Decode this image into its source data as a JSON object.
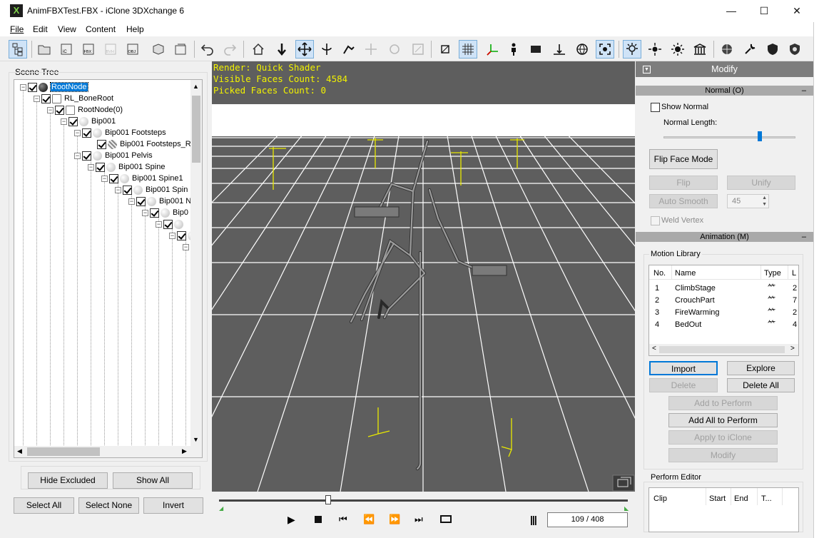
{
  "window": {
    "title": "AnimFBXTest.FBX - iClone 3DXchange 6",
    "minimize": "—",
    "maximize": "☐",
    "close": "✕"
  },
  "menu": [
    {
      "label": "File"
    },
    {
      "label": "Edit"
    },
    {
      "label": "View"
    },
    {
      "label": "Content"
    },
    {
      "label": "Help"
    }
  ],
  "scene_tree": {
    "label": "Scene Tree",
    "nodes": [
      {
        "label": "RootNode",
        "selected": true
      },
      {
        "label": "RL_BoneRoot"
      },
      {
        "label": "RootNode(0)"
      },
      {
        "label": "Bip001"
      },
      {
        "label": "Bip001 Footsteps"
      },
      {
        "label": "Bip001 Footsteps_R"
      },
      {
        "label": "Bip001 Pelvis"
      },
      {
        "label": "Bip001 Spine"
      },
      {
        "label": "Bip001 Spine1"
      },
      {
        "label": "Bip001 Spin"
      },
      {
        "label": "Bip001 N"
      },
      {
        "label": "Bip0"
      }
    ],
    "buttons": {
      "hide_excluded": "Hide Excluded",
      "show_all": "Show All",
      "select_all": "Select All",
      "select_none": "Select None",
      "invert": "Invert"
    }
  },
  "viewport": {
    "render": "Render: Quick Shader",
    "visible_faces": "Visible Faces Count: 4584",
    "picked_faces": "Picked Faces Count: 0"
  },
  "timeline": {
    "frame": "109 / 408",
    "progress": 0.267
  },
  "modify": {
    "title": "Modify",
    "normal_section": "Normal (O)",
    "show_normal": "Show Normal",
    "normal_length": "Normal Length:",
    "flip_face_mode": "Flip Face Mode",
    "flip": "Flip",
    "unify": "Unify",
    "auto_smooth": "Auto Smooth",
    "smooth_value": "45",
    "weld_vertex": "Weld Vertex",
    "animation_section": "Animation (M)",
    "motion_library": "Motion Library",
    "columns": {
      "no": "No.",
      "name": "Name",
      "type": "Type",
      "l": "L"
    },
    "motions": [
      {
        "no": "1",
        "name": "ClimbStage",
        "len": "2"
      },
      {
        "no": "2",
        "name": "CrouchPart",
        "len": "7"
      },
      {
        "no": "3",
        "name": "FireWarming",
        "len": "2"
      },
      {
        "no": "4",
        "name": "BedOut",
        "len": "4"
      }
    ],
    "import": "Import",
    "explore": "Explore",
    "delete": "Delete",
    "delete_all": "Delete All",
    "add_to_perform": "Add to Perform",
    "add_all_to_perform": "Add All to Perform",
    "apply_to_iclone": "Apply to iClone",
    "modify_btn": "Modify",
    "perform_editor": "Perform Editor",
    "pe_columns": {
      "clip": "Clip",
      "start": "Start",
      "end": "End",
      "t": "T..."
    }
  },
  "colors": {
    "viewport_bg": "#5e5e5e",
    "overlay_text": "#f2f200",
    "accent": "#0078d7"
  }
}
